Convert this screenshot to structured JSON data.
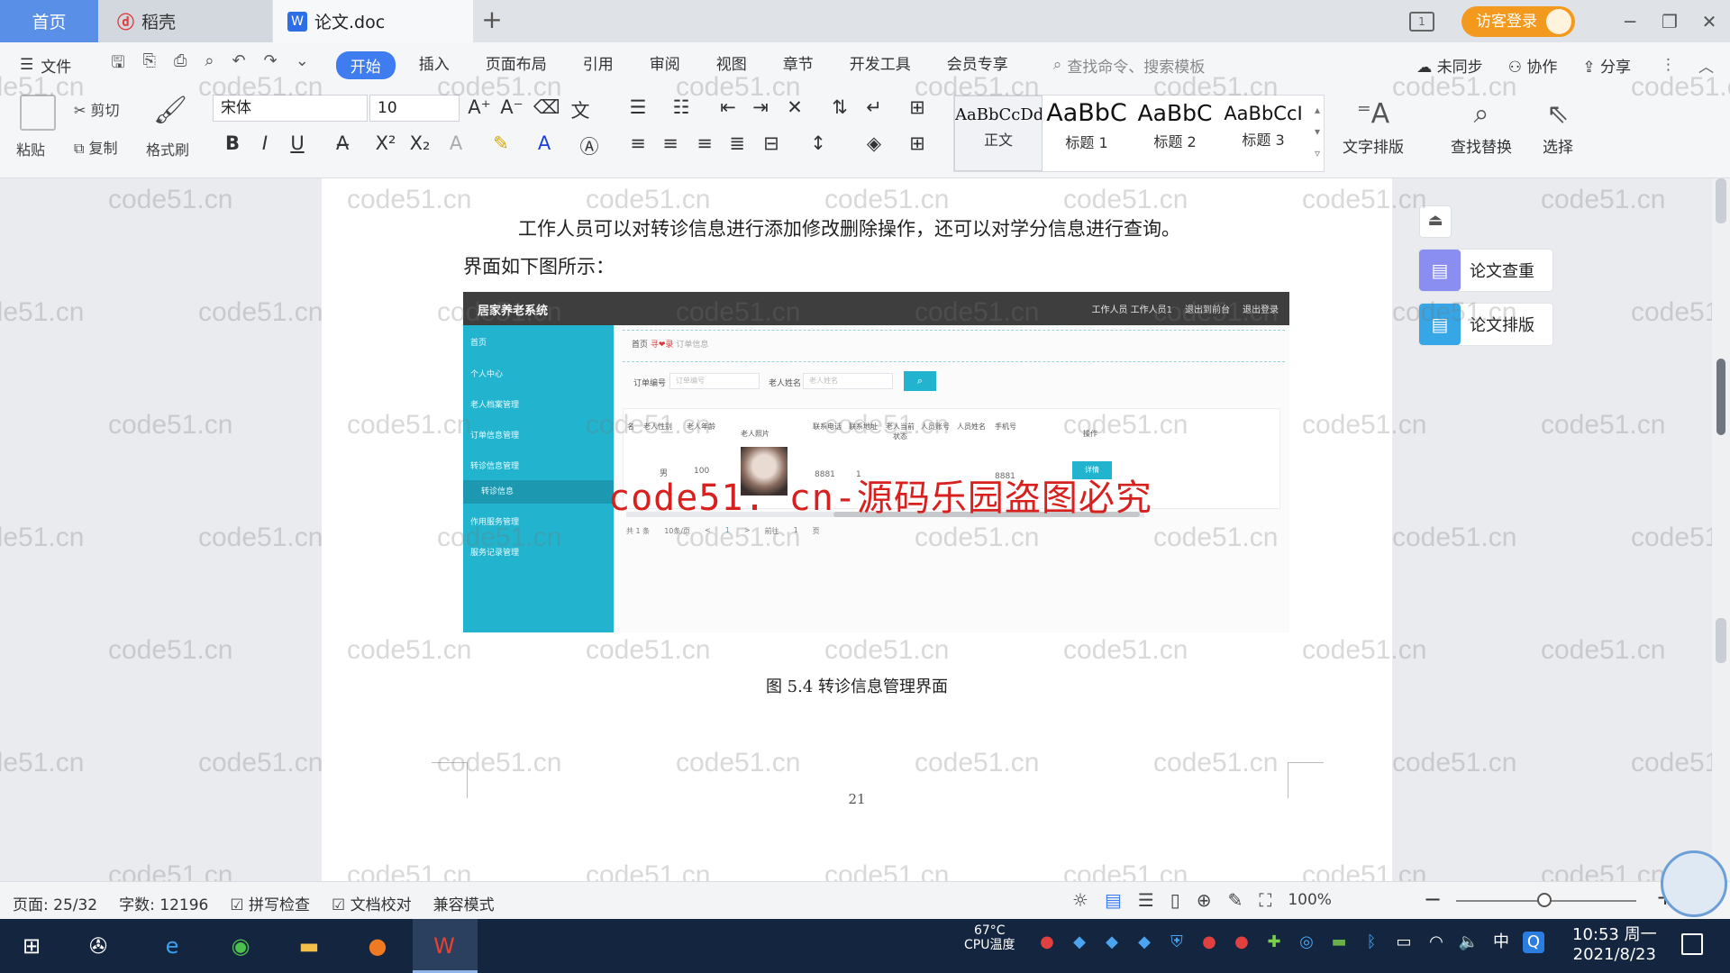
{
  "tabs": {
    "home": "首页",
    "daoke": "稻壳",
    "doc": "论文.doc",
    "new_tab": "+"
  },
  "titlebar": {
    "guest_login": "访客登录",
    "minimize": "─",
    "restore": "❐",
    "close": "✕"
  },
  "menu": {
    "file": "文件",
    "items": [
      "开始",
      "插入",
      "页面布局",
      "引用",
      "审阅",
      "视图",
      "章节",
      "开发工具",
      "会员专享"
    ],
    "search_placeholder": "查找命令、搜索模板",
    "sync": "未同步",
    "collab": "协作",
    "share": "分享"
  },
  "ribbon": {
    "paste": "粘贴",
    "cut": "剪切",
    "copy": "复制",
    "format_painter": "格式刷",
    "font_name": "宋体",
    "font_size": "10",
    "styles": [
      {
        "sample": "AaBbCcDd",
        "name": "正文"
      },
      {
        "sample": "AaBbC",
        "name": "标题 1"
      },
      {
        "sample": "AaBbC",
        "name": "标题 2"
      },
      {
        "sample": "AaBbCcI",
        "name": "标题 3"
      }
    ],
    "text_layout": "文字排版",
    "find_replace": "查找替换",
    "select": "选择"
  },
  "document": {
    "paragraph_line1": "工作人员可以对转诊信息进行添加修改删除操作，还可以对学分信息进行查询。",
    "paragraph_line2": "界面如下图所示：",
    "caption": "图 5.4  转诊信息管理界面",
    "page_number": "21",
    "stamp": "code51. cn-源码乐园盗图必究",
    "watermark": "code51.cn"
  },
  "embedded_screenshot": {
    "system_title": "居家养老系统",
    "top_right": [
      "工作人员 工作人员1",
      "退出到前台",
      "退出登录"
    ],
    "sidebar": [
      "首页",
      "个人中心",
      "老人档案管理",
      "订单信息管理",
      "转诊信息管理",
      "转诊信息",
      "作用服务管理",
      "服务记录管理"
    ],
    "breadcrumb_home": "首页",
    "breadcrumb_mid": "寻❤录",
    "breadcrumb_end": "订单信息",
    "filter_order_label": "订单编号",
    "filter_order_placeholder": "订单编号",
    "filter_name_label": "老人姓名",
    "filter_name_placeholder": "老人姓名",
    "table_headers": [
      "名",
      "老人性别",
      "老人年龄",
      "老人照片",
      "联系电话",
      "联系地址",
      "老人当前状态",
      "人员账号",
      "人员姓名",
      "手机号",
      "操作"
    ],
    "row_values": [
      "男",
      "100",
      "8881",
      "1",
      "8881"
    ],
    "edit_button": "详情",
    "pager": [
      "共 1 条",
      "10条/页",
      "<",
      "1",
      ">",
      "前往",
      "1",
      "页"
    ]
  },
  "side_panel": {
    "check": "论文查重",
    "layout": "论文排版"
  },
  "statusbar": {
    "page": "页面: 25/32",
    "words": "字数: 12196",
    "spellcheck": "拼写检查",
    "proofread": "文档校对",
    "compat": "兼容模式",
    "zoom": "100%",
    "zoom_level_percent": 100
  },
  "taskbar": {
    "temperature": "67°C",
    "cpu": "CPU温度",
    "ime": "中",
    "time": "10:53 周一",
    "date": "2021/8/23"
  },
  "colors": {
    "accent": "#3f7cf0",
    "home_tab": "#5a8fe8",
    "guest": "#f39a1e",
    "teal": "#22b4cf",
    "stamp": "#d8201e",
    "taskbar": "#14253f"
  }
}
